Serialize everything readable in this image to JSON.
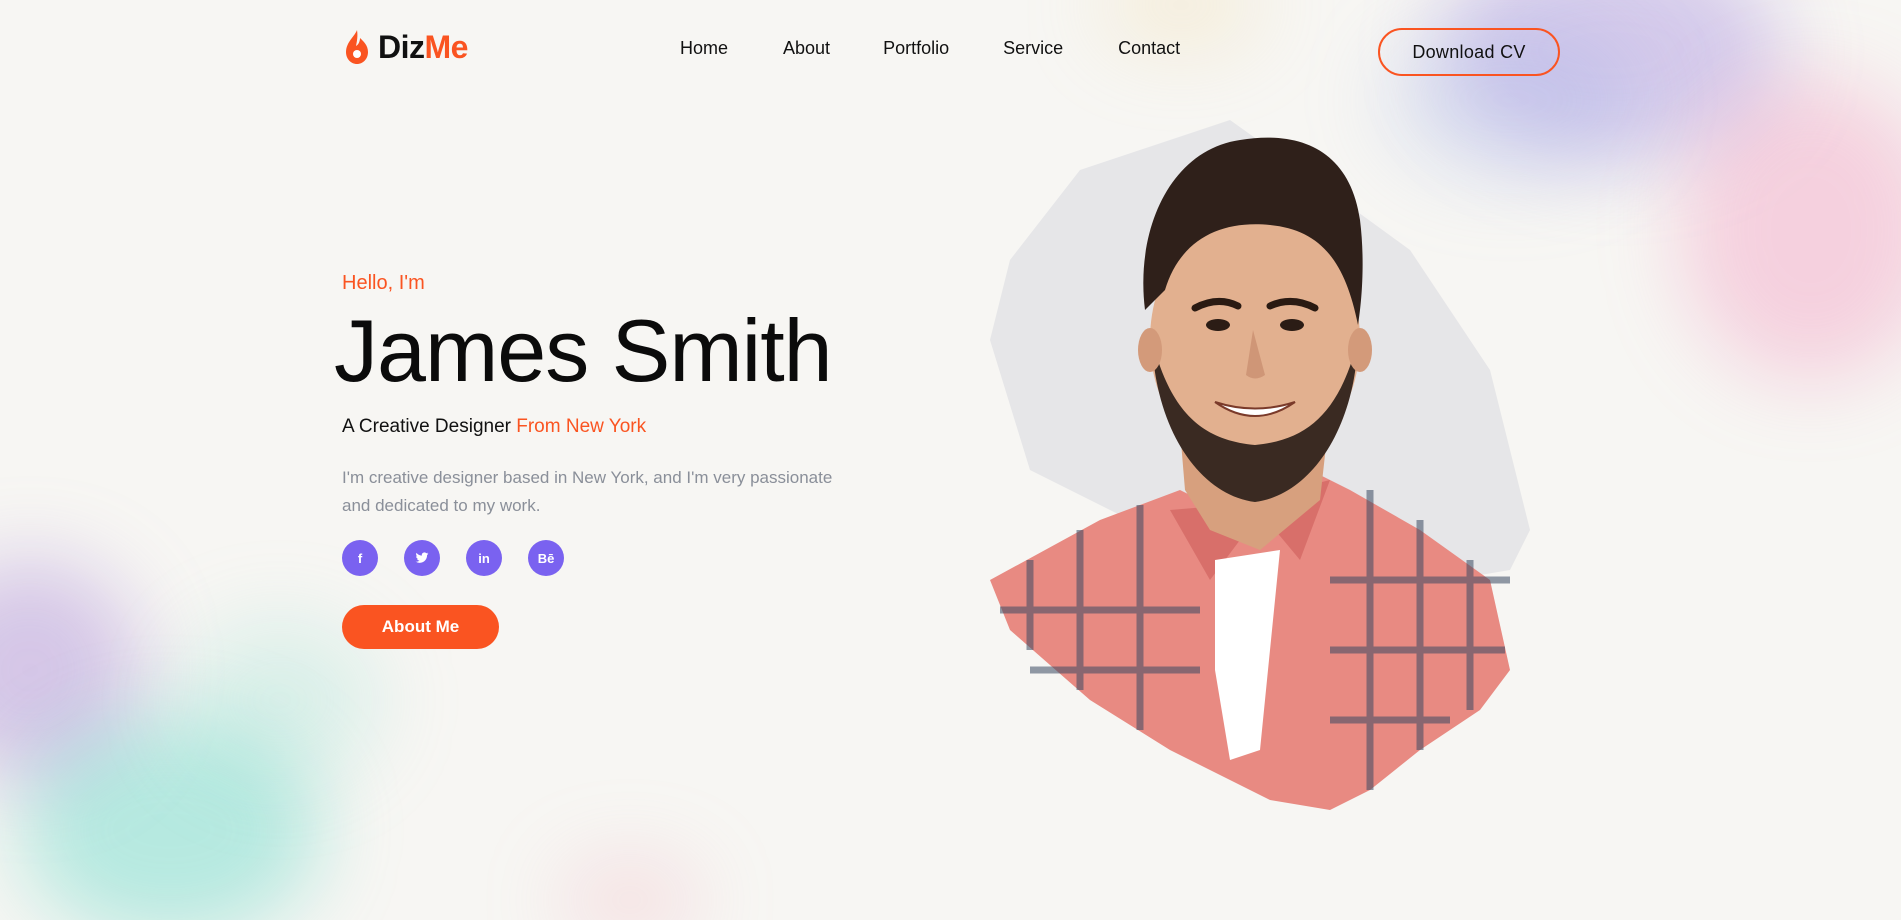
{
  "brand": {
    "logo_part1": "Diz",
    "logo_part2": "Me",
    "accent_color": "#fa5421",
    "social_color": "#7a62f0"
  },
  "nav": {
    "items": [
      {
        "label": "Home"
      },
      {
        "label": "About"
      },
      {
        "label": "Portfolio"
      },
      {
        "label": "Service"
      },
      {
        "label": "Contact"
      }
    ]
  },
  "header": {
    "cta_label": "Download CV"
  },
  "hero": {
    "greeting": "Hello, I'm",
    "name": "James Smith",
    "subtitle_prefix": "A Creative Designer ",
    "subtitle_highlight": "From New York",
    "description": "I'm creative designer based in New York, and I'm very passionate and dedicated to my work.",
    "socials": [
      {
        "icon": "facebook-icon",
        "glyph": "f"
      },
      {
        "icon": "twitter-icon",
        "glyph": ""
      },
      {
        "icon": "linkedin-icon",
        "glyph": "in"
      },
      {
        "icon": "behance-icon",
        "glyph": "Bē"
      }
    ],
    "button_label": "About Me"
  }
}
